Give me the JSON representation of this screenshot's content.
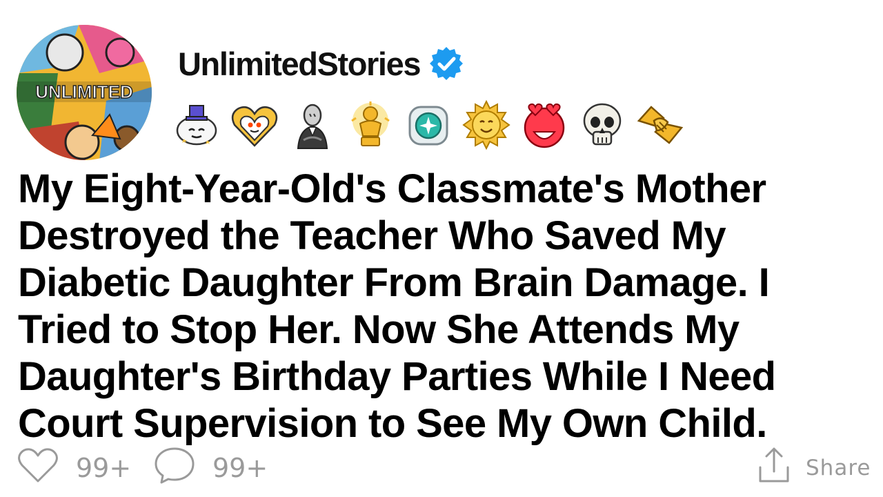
{
  "header": {
    "username": "UnlimitedStories",
    "avatar_text": "UNLIMITED",
    "verified_icon": "verified-badge-icon",
    "colors": {
      "verified": "#1d9bf0"
    }
  },
  "awards": [
    {
      "name": "wholesome-award-icon"
    },
    {
      "name": "heart-eyes-award-icon"
    },
    {
      "name": "bow-award-icon"
    },
    {
      "name": "gold-award-icon"
    },
    {
      "name": "platinum-award-icon"
    },
    {
      "name": "sun-award-icon"
    },
    {
      "name": "hearts-award-icon"
    },
    {
      "name": "skull-award-icon"
    },
    {
      "name": "handshake-award-icon"
    }
  ],
  "post": {
    "title": "My Eight-Year-Old's Classmate's Mother Destroyed the Teacher Who Saved My Diabetic Daughter From Brain Damage. I Tried to Stop Her. Now She Attends My Daughter's Birthday Parties While I Need Court Supervision to See My Own Child."
  },
  "footer": {
    "likes": "99+",
    "comments": "99+",
    "share_label": "Share"
  }
}
